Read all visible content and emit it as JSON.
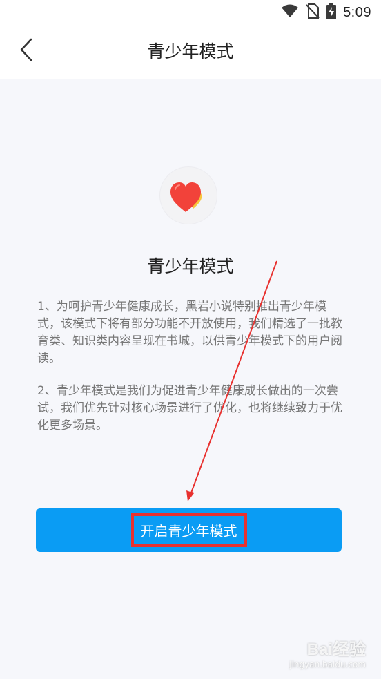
{
  "status_bar": {
    "time": "5:09",
    "icons": [
      "wifi-icon",
      "no-sim-icon",
      "battery-charging-icon"
    ]
  },
  "header": {
    "back_icon": "chevron-left-icon",
    "title": "青少年模式"
  },
  "main": {
    "badge_icon": "heart-icon",
    "heading": "青少年模式",
    "paragraphs": [
      "1、为呵护青少年健康成长，黑岩小说特别推出青少年模式，该模式下将有部分功能不开放使用，我们精选了一批教育类、知识类内容呈现在书城，以供青少年模式下的用户阅读。",
      "2、青少年模式是我们为促进青少年健康成长做出的一次尝试，我们优先针对核心场景进行了优化，也将继续致力于优化更多场景。"
    ],
    "button_label": "开启青少年模式"
  },
  "colors": {
    "accent": "#0a9cf4",
    "highlight": "#e8312f",
    "heart_red": "#f2423a",
    "heart_yellow": "#f7c63c"
  },
  "watermark": {
    "logo": "Bai经验",
    "sub": "jingyan.baidu.com"
  }
}
